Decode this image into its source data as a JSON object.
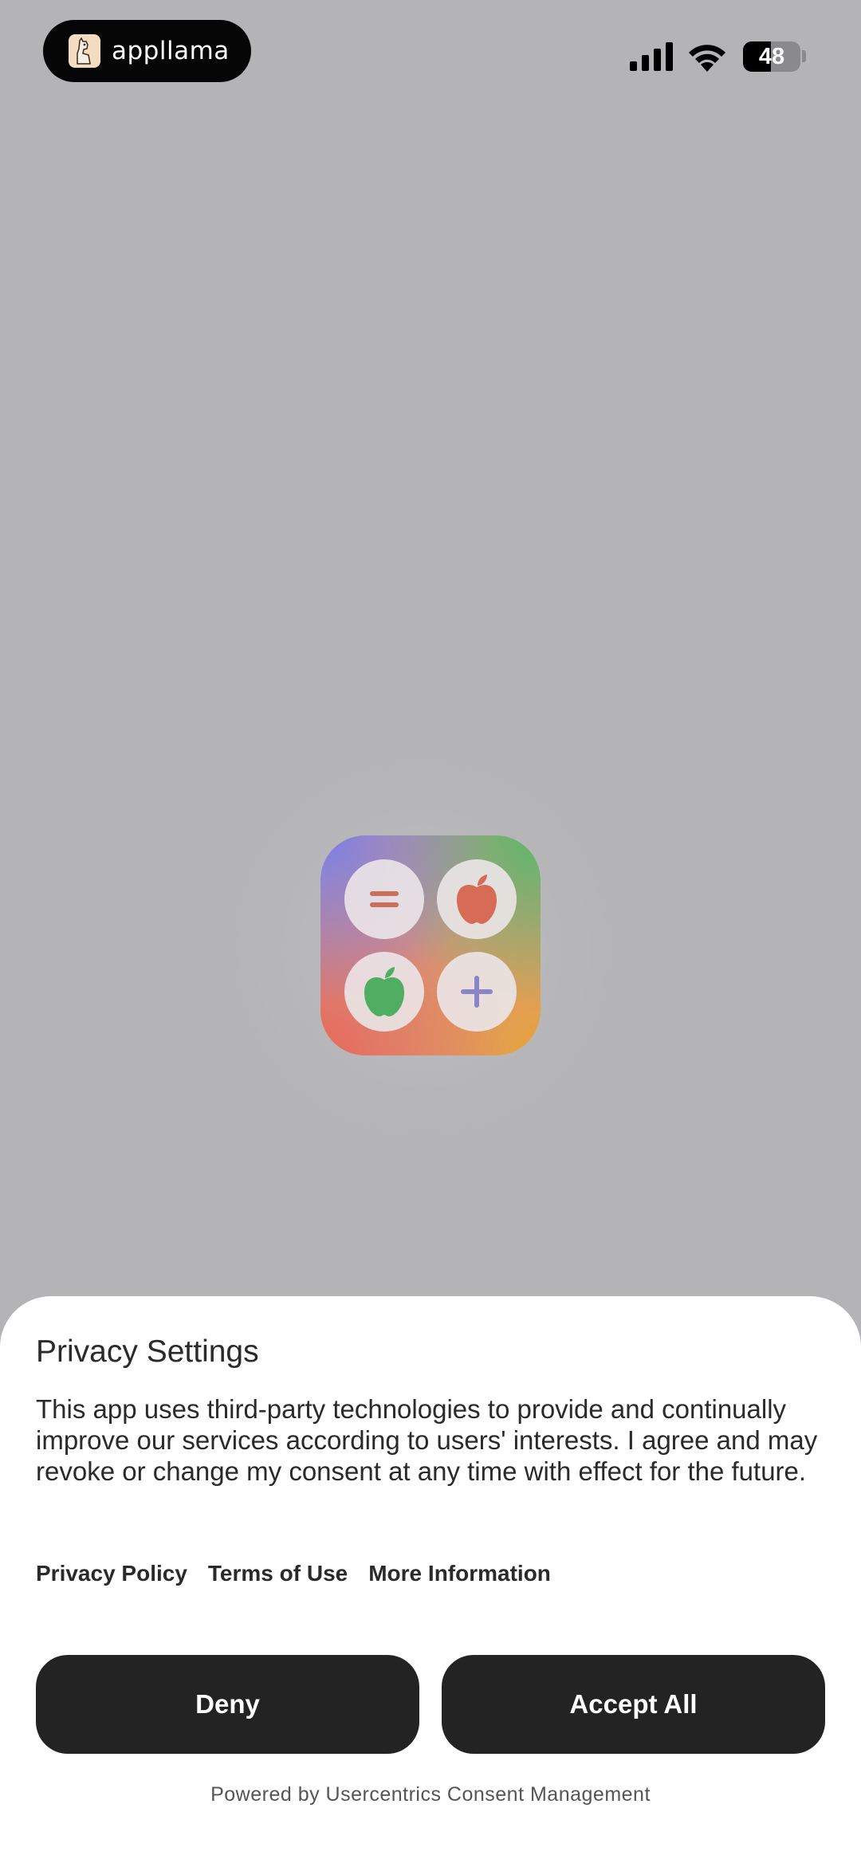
{
  "status_bar": {
    "brand_name": "appllama",
    "battery_percent": 48,
    "battery_label": "48",
    "icons": [
      "llama-logo-icon",
      "signal-icon",
      "wifi-icon",
      "battery-icon"
    ]
  },
  "app_icon": {
    "cells": [
      "equals-icon",
      "apple-icon",
      "apple-icon",
      "plus-icon"
    ],
    "colors": {
      "equals": "#c8705a",
      "red_apple": "#d76c56",
      "green_apple": "#4fae62",
      "plus": "#8a84c8"
    }
  },
  "consent": {
    "title": "Privacy Settings",
    "body": "This app uses third-party technologies to provide and continually improve our services according to users' interests. I agree and may revoke or change my consent at any time with effect for the future.",
    "links": [
      "Privacy Policy",
      "Terms of Use",
      "More Information"
    ],
    "deny_label": "Deny",
    "accept_label": "Accept All",
    "powered_by": "Powered by Usercentrics Consent Management"
  },
  "colors": {
    "backdrop": "#b4b4b6",
    "sheet": "#ffffff",
    "button": "#232323",
    "button_text": "#ffffff"
  }
}
